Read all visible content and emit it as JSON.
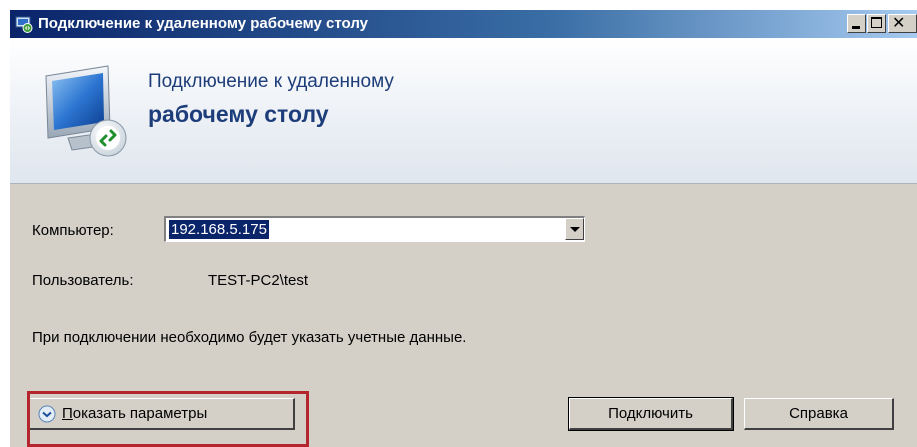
{
  "window": {
    "title": "Подключение к удаленному рабочему столу"
  },
  "banner": {
    "line1": "Подключение к удаленному",
    "line2": "рабочему столу"
  },
  "form": {
    "computer_label": "Компьютер:",
    "computer_value": "192.168.5.175",
    "user_label": "Пользователь:",
    "user_value": "TEST-PC2\\test",
    "info": "При подключении необходимо будет указать учетные данные."
  },
  "buttons": {
    "options_underlined": "П",
    "options_rest": "оказать параметры",
    "connect": "Подключить",
    "help": "Справка"
  },
  "colors": {
    "highlight": "#b5252e",
    "selection": "#0a246a",
    "title_bar": "#0a246a"
  },
  "icons": {
    "title": "remote-desktop-icon",
    "banner": "monitor-remote-icon",
    "options": "chevron-down-circle-icon"
  }
}
